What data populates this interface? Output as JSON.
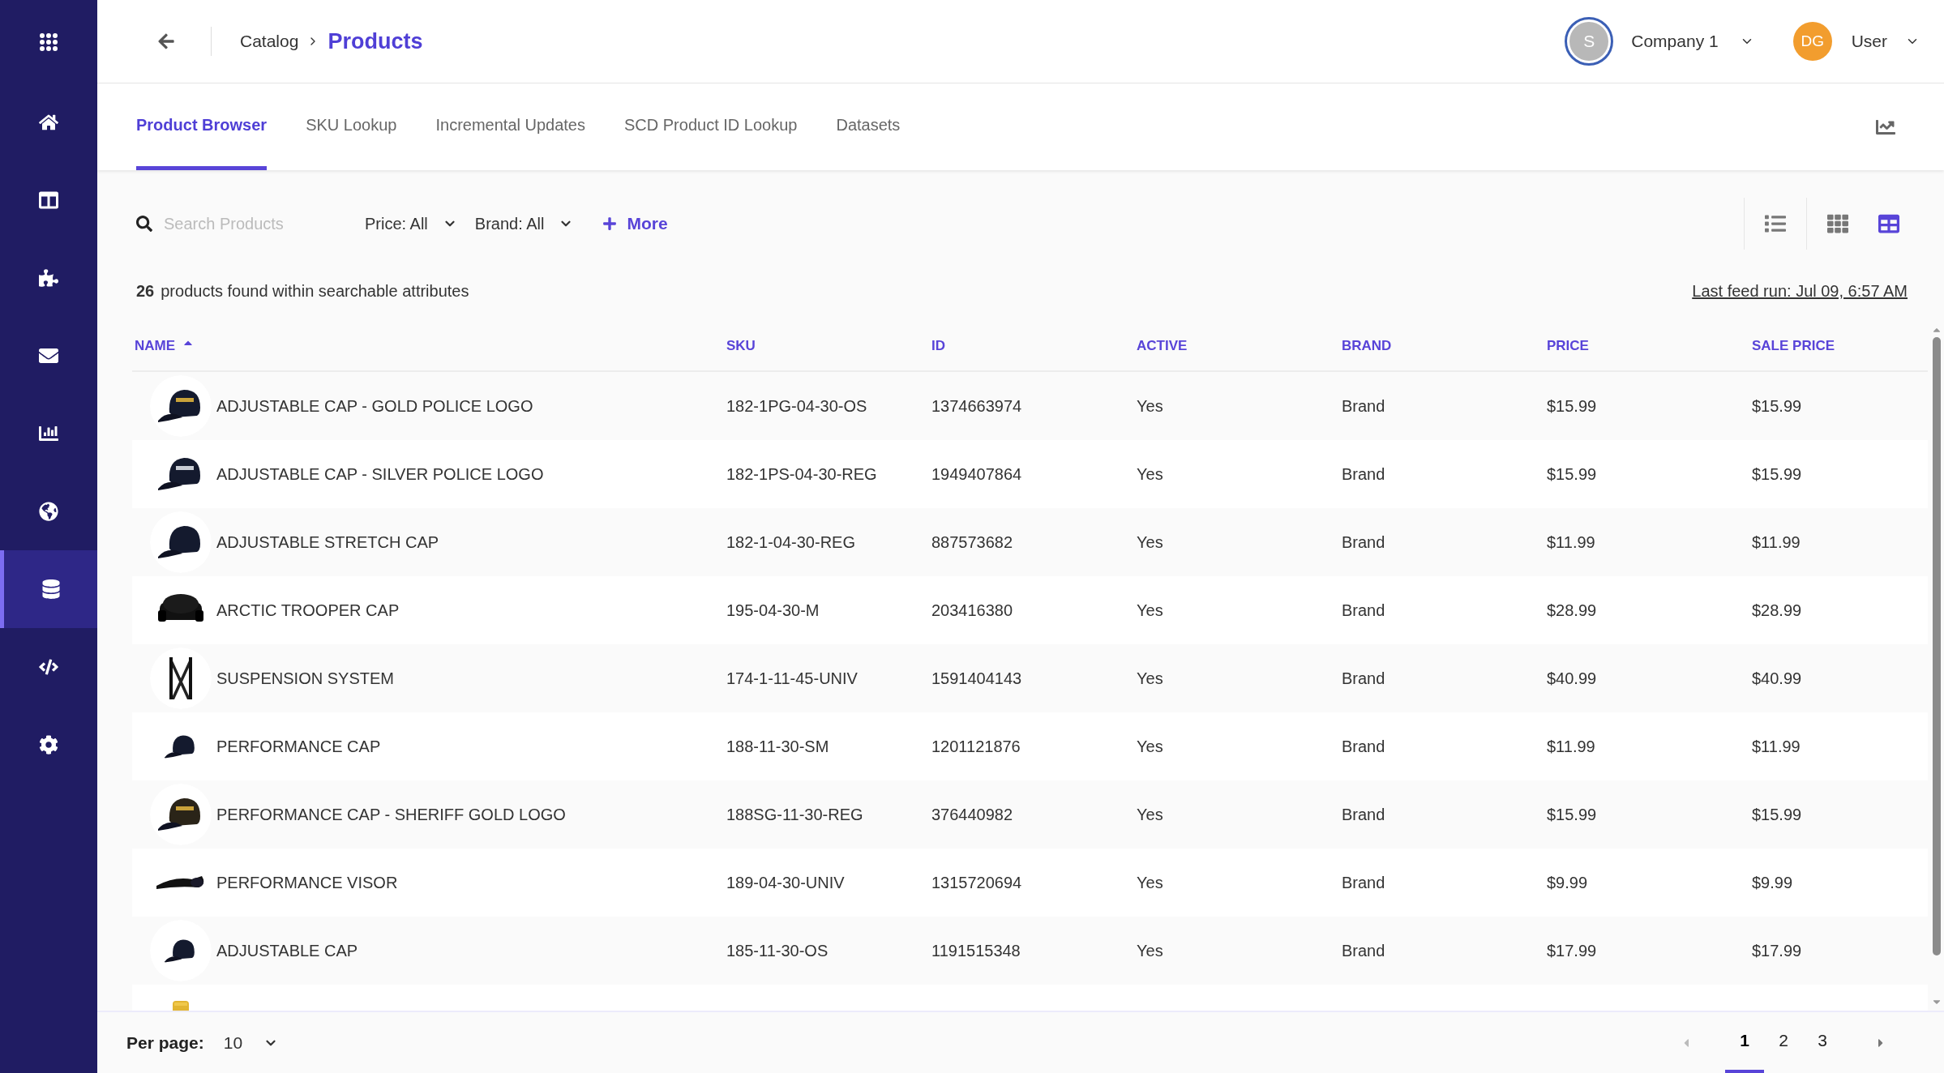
{
  "sidebar": {
    "items": [
      {
        "kind": "apps",
        "selected": false
      },
      {
        "kind": "home",
        "selected": false
      },
      {
        "kind": "columns",
        "selected": false
      },
      {
        "kind": "puzzle",
        "selected": false
      },
      {
        "kind": "mail",
        "selected": false
      },
      {
        "kind": "chart",
        "selected": false
      },
      {
        "kind": "globe",
        "selected": false
      },
      {
        "kind": "database",
        "selected": true
      },
      {
        "kind": "code",
        "selected": false
      },
      {
        "kind": "settings",
        "selected": false
      }
    ]
  },
  "header": {
    "breadcrumb": [
      "Catalog",
      "Products"
    ],
    "company": {
      "avatar": "S",
      "name": "Company 1"
    },
    "user": {
      "avatar": "DG",
      "name": "User"
    }
  },
  "tabs": [
    {
      "label": "Product Browser",
      "selected": true
    },
    {
      "label": "SKU Lookup",
      "selected": false
    },
    {
      "label": "Incremental Updates",
      "selected": false
    },
    {
      "label": "SCD Product ID Lookup",
      "selected": false
    },
    {
      "label": "Datasets",
      "selected": false
    }
  ],
  "filters": {
    "search": {
      "placeholder": "Search Products"
    },
    "dropdowns": [
      "Price: All",
      "Brand: All"
    ],
    "more": "More"
  },
  "views": [
    {
      "kind": "list",
      "selected": false
    },
    {
      "kind": "grid",
      "selected": false
    },
    {
      "kind": "table",
      "selected": true
    }
  ],
  "summary": {
    "count": "26",
    "text": "products found within searchable attributes",
    "last_feed": "Last feed run: Jul 09, 6:57 AM"
  },
  "table": {
    "columns": [
      {
        "label": "NAME",
        "sorted": true
      },
      {
        "label": "SKU",
        "sorted": false
      },
      {
        "label": "ID",
        "sorted": false
      },
      {
        "label": "ACTIVE",
        "sorted": false
      },
      {
        "label": "BRAND",
        "sorted": false
      },
      {
        "label": "PRICE",
        "sorted": false
      },
      {
        "label": "SALE PRICE",
        "sorted": false
      }
    ],
    "rows": [
      {
        "cells": [
          "ADJUSTABLE CAP - GOLD POLICE LOGO",
          "182-1PG-04-30-OS",
          "1374663974",
          "Yes",
          "Brand",
          "$15.99",
          "$15.99"
        ]
      },
      {
        "cells": [
          "ADJUSTABLE CAP - SILVER POLICE LOGO",
          "182-1PS-04-30-REG",
          "1949407864",
          "Yes",
          "Brand",
          "$15.99",
          "$15.99"
        ]
      },
      {
        "cells": [
          "ADJUSTABLE STRETCH CAP",
          "182-1-04-30-REG",
          "887573682",
          "Yes",
          "Brand",
          "$11.99",
          "$11.99"
        ]
      },
      {
        "cells": [
          "ARCTIC TROOPER CAP",
          "195-04-30-M",
          "203416380",
          "Yes",
          "Brand",
          "$28.99",
          "$28.99"
        ]
      },
      {
        "cells": [
          "SUSPENSION SYSTEM",
          "174-1-11-45-UNIV",
          "1591404143",
          "Yes",
          "Brand",
          "$40.99",
          "$40.99"
        ]
      },
      {
        "cells": [
          "PERFORMANCE CAP",
          "188-11-30-SM",
          "1201121876",
          "Yes",
          "Brand",
          "$11.99",
          "$11.99"
        ]
      },
      {
        "cells": [
          "PERFORMANCE CAP - SHERIFF GOLD LOGO",
          "188SG-11-30-REG",
          "376440982",
          "Yes",
          "Brand",
          "$15.99",
          "$15.99"
        ]
      },
      {
        "cells": [
          "PERFORMANCE VISOR",
          "189-04-30-UNIV",
          "1315720694",
          "Yes",
          "Brand",
          "$9.99",
          "$9.99"
        ]
      },
      {
        "cells": [
          "ADJUSTABLE CAP",
          "185-11-30-OS",
          "1191515348",
          "Yes",
          "Brand",
          "$17.99",
          "$17.99"
        ]
      },
      {
        "cells": []
      }
    ]
  },
  "footer": {
    "per_page_label": "Per page:",
    "per_page": "10",
    "pages": [
      {
        "label": "1",
        "selected": true
      },
      {
        "label": "2",
        "selected": false
      },
      {
        "label": "3",
        "selected": false
      }
    ]
  }
}
